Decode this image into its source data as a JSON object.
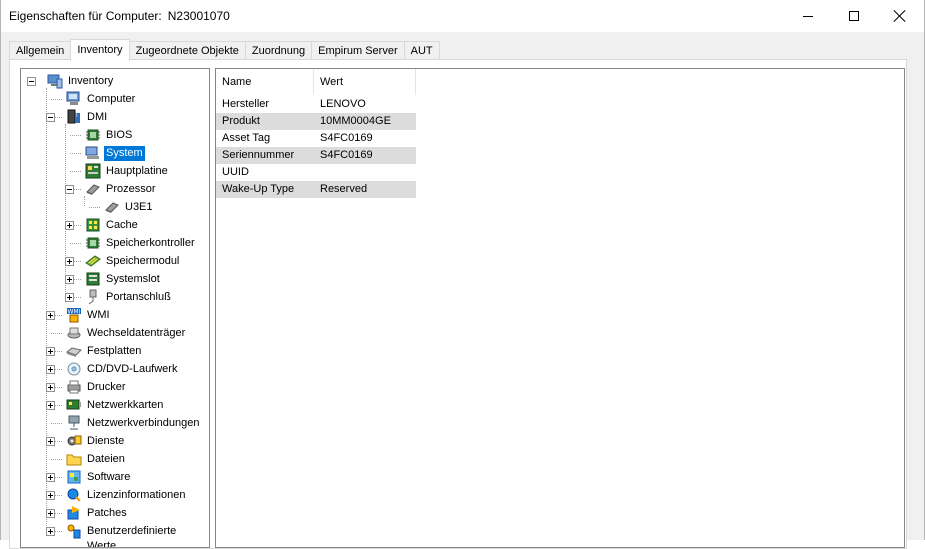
{
  "window": {
    "title_label": "Eigenschaften für Computer:",
    "title_value": "N23001070"
  },
  "tabs": [
    {
      "label": "Allgemein"
    },
    {
      "label": "Inventory",
      "active": true
    },
    {
      "label": "Zugeordnete Objekte"
    },
    {
      "label": "Zuordnung"
    },
    {
      "label": "Empirum Server"
    },
    {
      "label": "AUT"
    }
  ],
  "tree": [
    {
      "label": "Inventory",
      "icon": "inventory-icon",
      "level": 0,
      "expander": "minus"
    },
    {
      "label": "Computer",
      "icon": "computer-icon",
      "level": 1
    },
    {
      "label": "DMI",
      "icon": "dmi-icon",
      "level": 1,
      "expander": "minus"
    },
    {
      "label": "BIOS",
      "icon": "chip-icon",
      "level": 2
    },
    {
      "label": "System",
      "icon": "system-icon",
      "level": 2,
      "selected": true
    },
    {
      "label": "Hauptplatine",
      "icon": "mainboard-icon",
      "level": 2
    },
    {
      "label": "Prozessor",
      "icon": "processor-icon",
      "level": 2,
      "expander": "minus"
    },
    {
      "label": "U3E1",
      "icon": "processor-icon",
      "level": 3
    },
    {
      "label": "Cache",
      "icon": "cache-icon",
      "level": 2,
      "expander": "plus"
    },
    {
      "label": "Speicherkontroller",
      "icon": "chip-icon",
      "level": 2
    },
    {
      "label": "Speichermodul",
      "icon": "memory-icon",
      "level": 2,
      "expander": "plus"
    },
    {
      "label": "Systemslot",
      "icon": "slot-icon",
      "level": 2,
      "expander": "plus"
    },
    {
      "label": "Portanschluß",
      "icon": "port-icon",
      "level": 2,
      "expander": "plus"
    },
    {
      "label": "WMI",
      "icon": "wmi-icon",
      "level": 1,
      "expander": "plus"
    },
    {
      "label": "Wechseldatenträger",
      "icon": "removable-drive-icon",
      "level": 1
    },
    {
      "label": "Festplatten",
      "icon": "harddisk-icon",
      "level": 1,
      "expander": "plus"
    },
    {
      "label": "CD/DVD-Laufwerk",
      "icon": "cd-drive-icon",
      "level": 1,
      "expander": "plus"
    },
    {
      "label": "Drucker",
      "icon": "printer-icon",
      "level": 1,
      "expander": "plus"
    },
    {
      "label": "Netzwerkkarten",
      "icon": "network-card-icon",
      "level": 1,
      "expander": "plus"
    },
    {
      "label": "Netzwerkverbindungen",
      "icon": "network-connection-icon",
      "level": 1
    },
    {
      "label": "Dienste",
      "icon": "services-icon",
      "level": 1,
      "expander": "plus"
    },
    {
      "label": "Dateien",
      "icon": "folder-icon",
      "level": 1
    },
    {
      "label": "Software",
      "icon": "software-icon",
      "level": 1,
      "expander": "plus"
    },
    {
      "label": "Lizenzinformationen",
      "icon": "license-icon",
      "level": 1,
      "expander": "plus"
    },
    {
      "label": "Patches",
      "icon": "patches-icon",
      "level": 1,
      "expander": "plus"
    },
    {
      "label": "Benutzerdefinierte Werte",
      "icon": "custom-values-icon",
      "level": 1,
      "expander": "plus"
    }
  ],
  "list": {
    "columns": [
      "Name",
      "Wert"
    ],
    "rows": [
      {
        "name": "Hersteller",
        "value": "LENOVO"
      },
      {
        "name": "Produkt",
        "value": "10MM0004GE"
      },
      {
        "name": "Asset Tag",
        "value": "S4FC0169"
      },
      {
        "name": "Seriennummer",
        "value": "S4FC0169"
      },
      {
        "name": "UUID",
        "value": ""
      },
      {
        "name": "Wake-Up Type",
        "value": "Reserved"
      }
    ]
  },
  "colors": {
    "selection": "#0078d7",
    "row_alt": "#dcdcdc",
    "pane_border": "#828790"
  }
}
